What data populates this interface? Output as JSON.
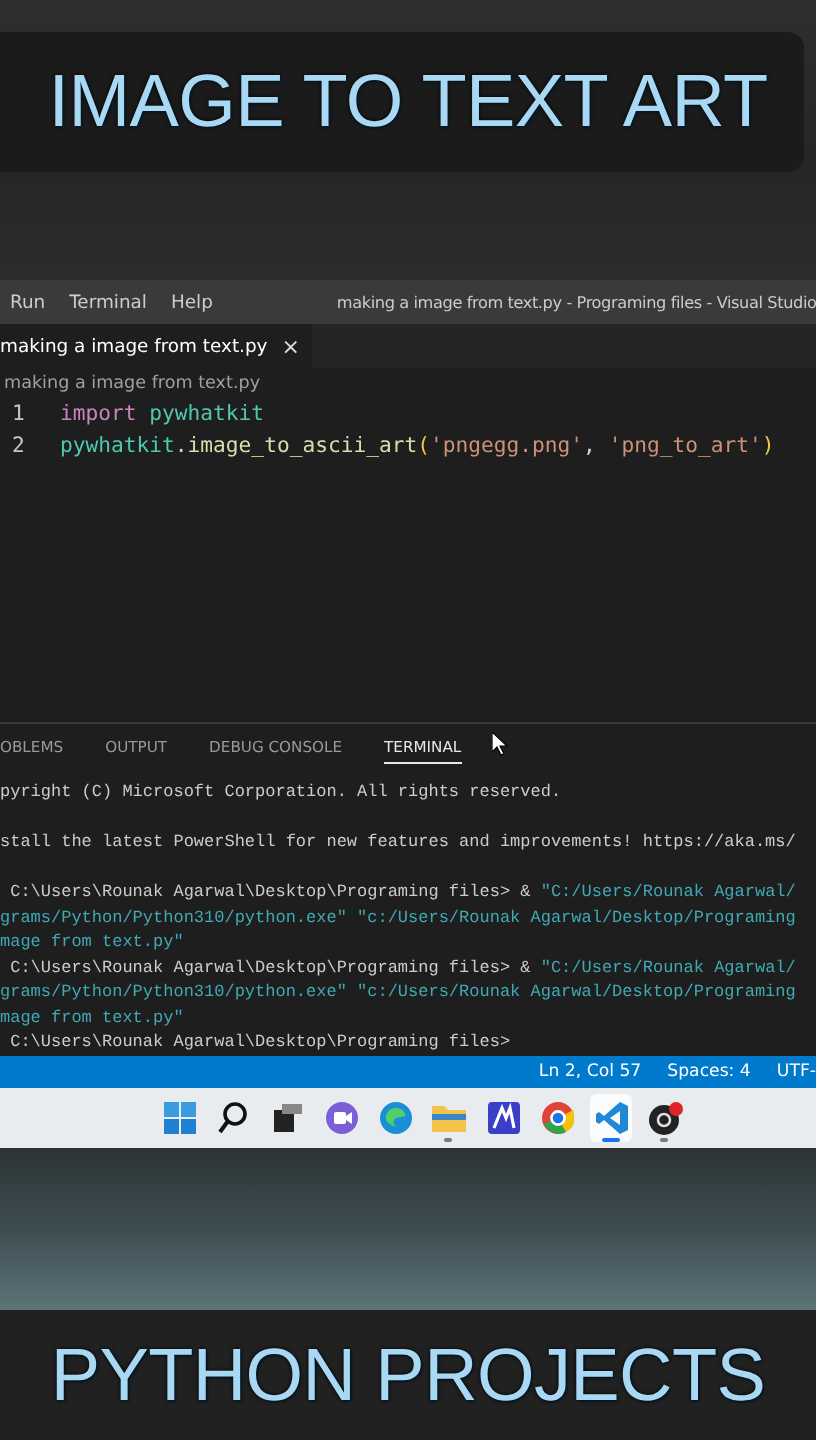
{
  "video_title": "IMAGE TO TEXT ART",
  "menu": [
    {
      "label": "Run"
    },
    {
      "label": "Terminal"
    },
    {
      "label": "Help"
    }
  ],
  "window": {
    "title": "making a image from text.py - Programing files - Visual Studio"
  },
  "tabs": [
    {
      "label": "making a image from text.py",
      "selected": true,
      "close": "×"
    }
  ],
  "breadcrumb": "making a image from text.py",
  "code_lines": [
    {
      "number": "1",
      "tokens": [
        {
          "text": "import ",
          "kind": "keyword"
        },
        {
          "text": "pywhatkit",
          "kind": "module"
        }
      ]
    },
    {
      "number": "2",
      "tokens": [
        {
          "text": "pywhatkit",
          "kind": "module"
        },
        {
          "text": ".",
          "kind": "plain"
        },
        {
          "text": "image_to_ascii_art",
          "kind": "function"
        },
        {
          "text": "(",
          "kind": "bracket"
        },
        {
          "text": "'pngegg.png'",
          "kind": "string"
        },
        {
          "text": ", ",
          "kind": "plain"
        },
        {
          "text": "'png_to_art'",
          "kind": "string"
        },
        {
          "text": ")",
          "kind": "bracket"
        }
      ]
    }
  ],
  "panel_tabs": [
    {
      "label": "OBLEMS",
      "selected": false
    },
    {
      "label": "OUTPUT",
      "selected": false
    },
    {
      "label": "DEBUG CONSOLE",
      "selected": false
    },
    {
      "label": "TERMINAL",
      "selected": true
    }
  ],
  "terminal_lines": [
    {
      "segments": [
        {
          "text": "pyright (C) Microsoft Corporation. All rights reserved.",
          "kind": "plain"
        }
      ]
    },
    {
      "gap_before": true,
      "segments": [
        {
          "text": "stall the latest PowerShell for new features and improvements! https://aka.ms/",
          "kind": "plain"
        }
      ]
    },
    {
      "gap_before": true,
      "segments": [
        {
          "text": " C:\\Users\\Rounak Agarwal\\Desktop\\Programing files> & ",
          "kind": "plain"
        },
        {
          "text": "\"C:/Users/Rounak Agarwal/",
          "kind": "string"
        }
      ]
    },
    {
      "segments": [
        {
          "text": "grams/Python/Python310/python.exe\" \"c:/Users/Rounak Agarwal/Desktop/Programing",
          "kind": "string"
        }
      ]
    },
    {
      "segments": [
        {
          "text": "mage from text.py\"",
          "kind": "string"
        }
      ]
    },
    {
      "segments": [
        {
          "text": " C:\\Users\\Rounak Agarwal\\Desktop\\Programing files> & ",
          "kind": "plain"
        },
        {
          "text": "\"C:/Users/Rounak Agarwal/",
          "kind": "string"
        }
      ]
    },
    {
      "segments": [
        {
          "text": "grams/Python/Python310/python.exe\" \"c:/Users/Rounak Agarwal/Desktop/Programing",
          "kind": "string"
        }
      ]
    },
    {
      "segments": [
        {
          "text": "mage from text.py\"",
          "kind": "string"
        }
      ]
    },
    {
      "segments": [
        {
          "text": " C:\\Users\\Rounak Agarwal\\Desktop\\Programing files>",
          "kind": "plain"
        }
      ]
    }
  ],
  "status_bar": [
    "Ln 2, Col 57",
    "Spaces: 4",
    "UTF-"
  ],
  "taskbar": [
    {
      "kind": "start",
      "selected": false,
      "running": false
    },
    {
      "kind": "search",
      "selected": false,
      "running": false
    },
    {
      "kind": "taskview",
      "selected": false,
      "running": false
    },
    {
      "kind": "chat",
      "selected": false,
      "running": false
    },
    {
      "kind": "edge",
      "selected": false,
      "running": false
    },
    {
      "kind": "folder",
      "selected": false,
      "running": true
    },
    {
      "kind": "editor",
      "selected": false,
      "running": false
    },
    {
      "kind": "chrome",
      "selected": false,
      "running": false
    },
    {
      "kind": "vscode",
      "selected": true,
      "running": true
    },
    {
      "kind": "recorder",
      "selected": false,
      "running": true
    }
  ],
  "footer_title": "PYTHON PROJECTS"
}
